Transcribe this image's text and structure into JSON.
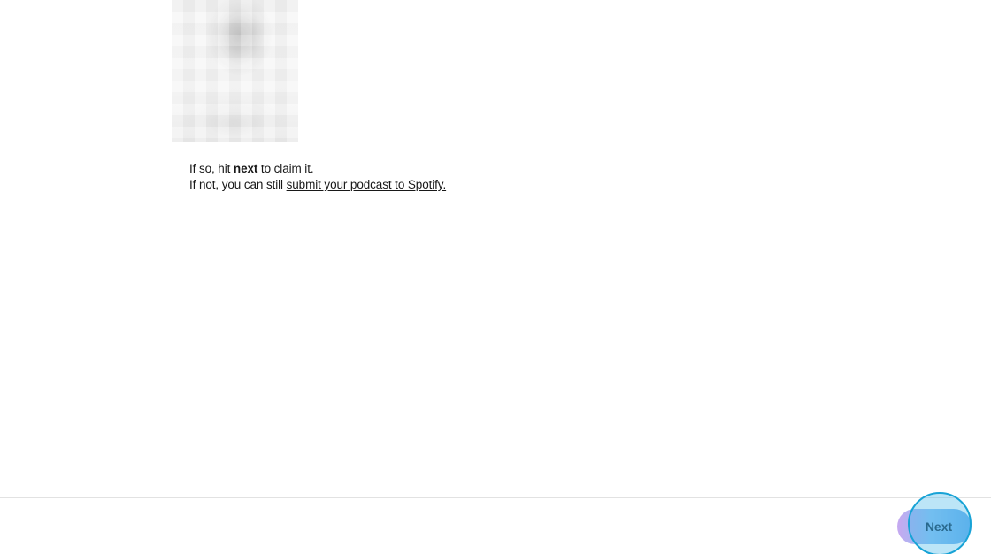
{
  "claim": {
    "line1_prefix": "If so, hit ",
    "line1_bold": "next",
    "line1_suffix": " to claim it.",
    "line2_prefix": "If not, you can still ",
    "line2_link": "submit your podcast to Spotify."
  },
  "footer": {
    "next_label": "Next"
  },
  "colors": {
    "next_button_gradient_start": "#c6a8f0",
    "next_button_gradient_end": "#6ab0ee",
    "click_indicator": "#18a3d6"
  }
}
